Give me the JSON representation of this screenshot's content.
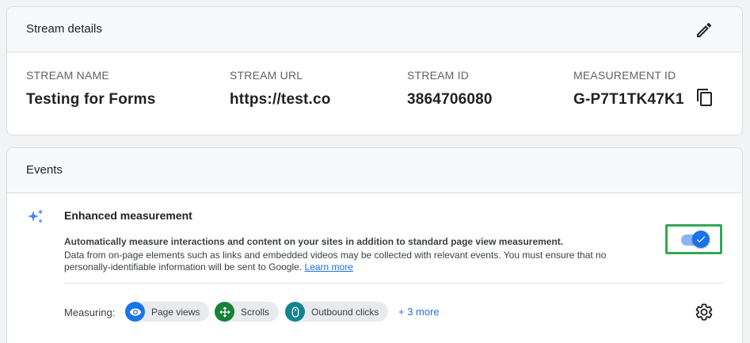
{
  "stream_details": {
    "title": "Stream details",
    "fields": [
      {
        "label": "STREAM NAME",
        "value": "Testing for Forms"
      },
      {
        "label": "STREAM URL",
        "value": "https://test.co"
      },
      {
        "label": "STREAM ID",
        "value": "3864706080"
      },
      {
        "label": "MEASUREMENT ID",
        "value": "G-P7T1TK47K1"
      }
    ],
    "edit_icon": "pencil-icon",
    "copy_icon": "copy-icon"
  },
  "events": {
    "title": "Events",
    "enhanced": {
      "icon": "sparkle-icon",
      "title": "Enhanced measurement",
      "description_bold": "Automatically measure interactions and content on your sites in addition to standard page view measurement.",
      "description": "Data from on-page elements such as links and embedded videos may be collected with relevant events. You must ensure that no personally-identifiable information will be sent to Google.",
      "learn_more": "Learn more",
      "toggle_on": true
    },
    "measuring": {
      "label": "Measuring:",
      "chips": [
        {
          "label": "Page views",
          "icon": "eye-icon",
          "color": "#1a73e8"
        },
        {
          "label": "Scrolls",
          "icon": "scroll-icon",
          "color": "#188038"
        },
        {
          "label": "Outbound clicks",
          "icon": "mouse-icon",
          "color": "#12848f"
        }
      ],
      "more": "+ 3 more",
      "settings_icon": "gear-icon"
    }
  },
  "colors": {
    "accent": "#1a73e8",
    "highlight": "#34a853"
  }
}
